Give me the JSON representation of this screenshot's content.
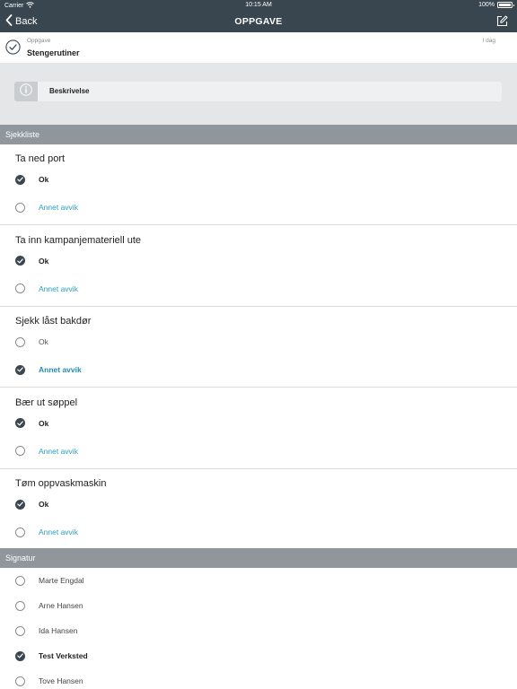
{
  "status": {
    "carrier": "Carrier",
    "time": "10:15 AM",
    "battery": "100%",
    "battery_level": 1.0
  },
  "nav": {
    "back_label": "Back",
    "title": "OPPGAVE"
  },
  "task": {
    "label": "Oppgave",
    "name": "Stengerutiner",
    "time": "I dag"
  },
  "description": {
    "label": "Beskrivelse"
  },
  "checklist": {
    "header": "Sjekkliste",
    "ok_label": "Ok",
    "avvik_label": "Annet avvik",
    "items": [
      {
        "title": "Ta ned port",
        "selected": "ok"
      },
      {
        "title": "Ta inn kampanjemateriell ute",
        "selected": "ok"
      },
      {
        "title": "Sjekk låst bakdør",
        "selected": "avvik"
      },
      {
        "title": "Bær ut søppel",
        "selected": "ok"
      },
      {
        "title": "Tøm oppvaskmaskin",
        "selected": "ok"
      }
    ]
  },
  "signature": {
    "header": "Signatur",
    "people": [
      {
        "name": "Marte Engdal",
        "selected": false
      },
      {
        "name": "Arne Hansen",
        "selected": false
      },
      {
        "name": "Ida Hansen",
        "selected": false
      },
      {
        "name": "Test Verksted",
        "selected": true
      },
      {
        "name": "Tove Hansen",
        "selected": false
      }
    ]
  },
  "colors": {
    "nav_bg": "#39464f",
    "section_bg": "#8f969c",
    "accent": "#2a9fc2",
    "checked": "#3c4750"
  }
}
